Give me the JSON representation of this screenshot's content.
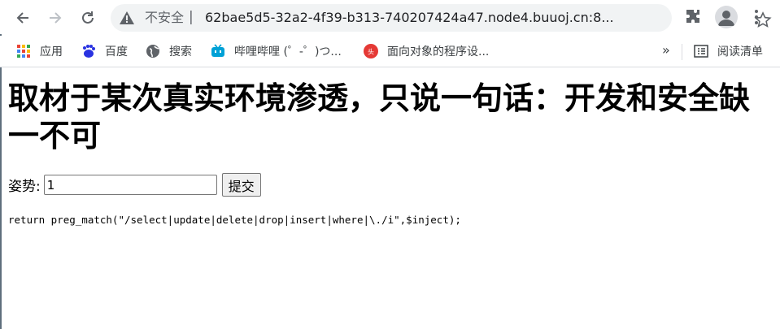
{
  "browser": {
    "address": {
      "security_text": "不安全",
      "separator": "|",
      "url": "62bae5d5-32a2-4f39-b313-740207424a47.node4.buuoj.cn:8..."
    },
    "bookmarks": [
      {
        "label": "应用",
        "icon": "apps-grid-icon"
      },
      {
        "label": "百度",
        "icon": "baidu-icon"
      },
      {
        "label": "搜索",
        "icon": "globe-icon"
      },
      {
        "label": "哔哩哔哩 (゜-゜)つ...",
        "icon": "bilibili-icon"
      },
      {
        "label": "面向对象的程序设...",
        "icon": "toutiao-icon"
      }
    ],
    "more_bookmarks": "»",
    "reading_list": "阅读清单"
  },
  "page": {
    "heading": "取材于某次真实环境渗透，只说一句话：开发和安全缺一不可",
    "form": {
      "label": "姿势:",
      "input_value": "1",
      "submit_label": "提交"
    },
    "code_line": "return preg_match(\"/select|update|delete|drop|insert|where|\\./i\",$inject);"
  }
}
